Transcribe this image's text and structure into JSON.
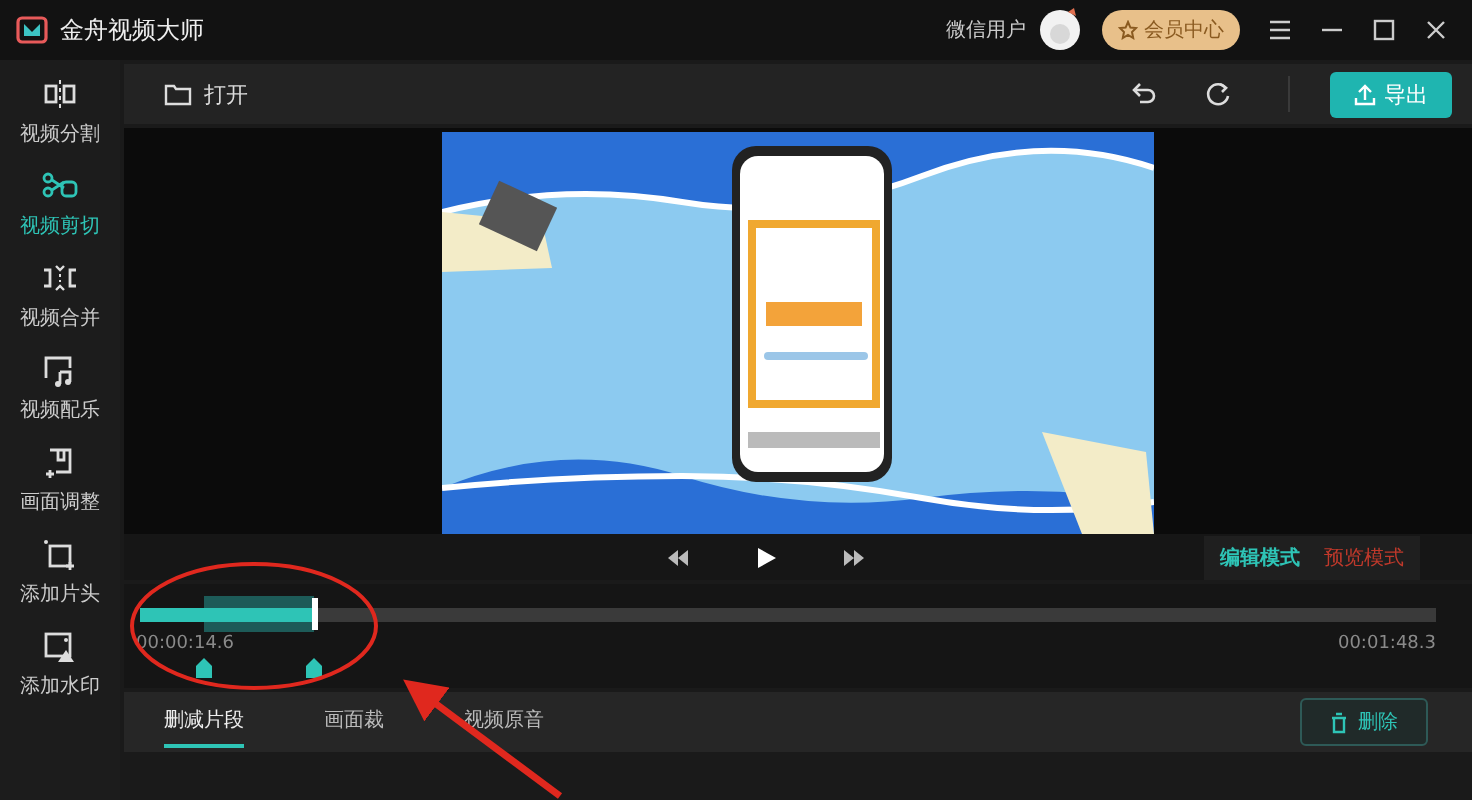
{
  "window": {
    "title": "金舟视频大师",
    "user": "微信用户",
    "vip_button": "会员中心"
  },
  "sidebar": {
    "items": [
      {
        "label": "视频分割",
        "selected": false,
        "kind": "split"
      },
      {
        "label": "视频剪切",
        "selected": true,
        "kind": "cut"
      },
      {
        "label": "视频合并",
        "selected": false,
        "kind": "merge"
      },
      {
        "label": "视频配乐",
        "selected": false,
        "kind": "music"
      },
      {
        "label": "画面调整",
        "selected": false,
        "kind": "adjust"
      },
      {
        "label": "添加片头",
        "selected": false,
        "kind": "intro"
      },
      {
        "label": "添加水印",
        "selected": false,
        "kind": "watermark"
      }
    ]
  },
  "toolbar": {
    "open": "打开",
    "export": "导出"
  },
  "preview": {
    "modes": [
      {
        "label": "编辑模式",
        "selected": true,
        "color": "#2ec4b6"
      },
      {
        "label": "预览模式",
        "selected": false,
        "color": "#c0392b"
      }
    ]
  },
  "timeline": {
    "level": 0.134,
    "selection": {
      "level": 0.05
    },
    "current_time": "00:00:14.6",
    "total_time": "00:01:48.3"
  },
  "bottom": {
    "tabs": [
      {
        "label": "删减片段",
        "selected": true
      },
      {
        "label": "画面裁",
        "selected": false
      },
      {
        "label": "视频原音",
        "selected": false
      }
    ],
    "delete": "删除"
  }
}
